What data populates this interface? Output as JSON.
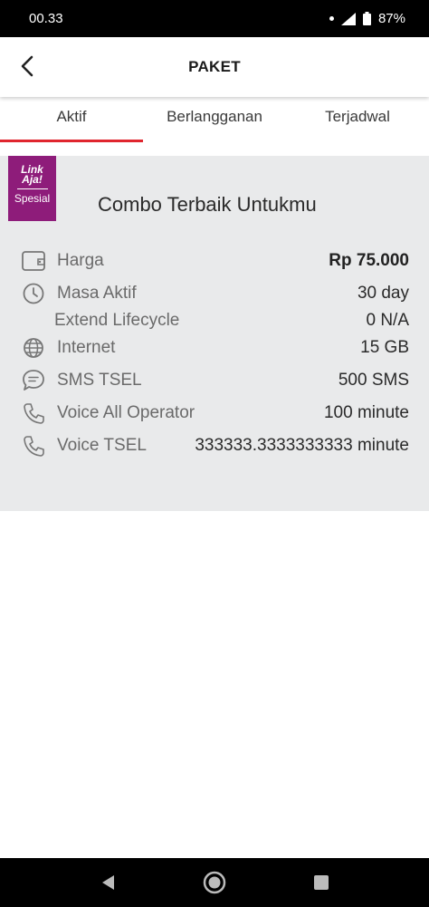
{
  "status_bar": {
    "time": "00.33",
    "battery": "87%"
  },
  "header": {
    "title": "PAKET"
  },
  "tabs": [
    {
      "label": "Aktif"
    },
    {
      "label": "Berlangganan"
    },
    {
      "label": "Terjadwal"
    }
  ],
  "package": {
    "badge_logo_line1": "Link",
    "badge_logo_line2": "Aja!",
    "badge_label": "Spesial",
    "name": "Combo Terbaik Untukmu",
    "rows": [
      {
        "label": "Harga",
        "value": "Rp 75.000"
      },
      {
        "label": "Masa Aktif",
        "value": "30 day"
      },
      {
        "label": "Extend Lifecycle",
        "value": "0 N/A"
      },
      {
        "label": "Internet",
        "value": "15 GB"
      },
      {
        "label": "SMS TSEL",
        "value": "500 SMS"
      },
      {
        "label": "Voice All Operator",
        "value": "100 minute"
      },
      {
        "label": "Voice TSEL",
        "value": "333333.3333333333 minute"
      }
    ]
  },
  "colors": {
    "accent": "#e0262e",
    "badge": "#8e1c7a",
    "card": "#e9eaeb"
  }
}
